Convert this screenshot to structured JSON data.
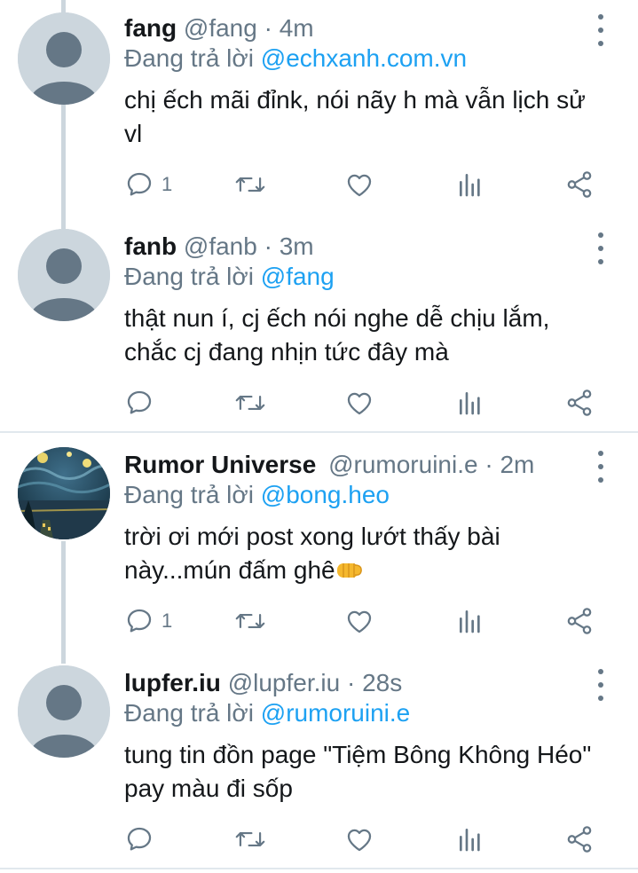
{
  "tweets": [
    {
      "name": "fang",
      "handle": "@fang",
      "sep": "·",
      "time": "4m",
      "reply_prefix": "Đang trả lời",
      "reply_to": "@echxanh.com.vn",
      "text": "chị ếch mãi đỉnk, nói nãy h mà vẫn lịch sử vl",
      "reply_count": "1",
      "retweet_count": "",
      "like_count": ""
    },
    {
      "name": "fanb",
      "handle": "@fanb",
      "sep": "·",
      "time": "3m",
      "reply_prefix": "Đang trả lời",
      "reply_to": "@fang",
      "text": "thật nun í, cj ếch nói nghe dễ chịu lắm, chắc cj đang nhịn tức đây mà",
      "reply_count": "",
      "retweet_count": "",
      "like_count": ""
    },
    {
      "name": "Rumor Universe",
      "handle": "@rumoruini.e",
      "sep": "·",
      "time": "2m",
      "reply_prefix": "Đang trả lời",
      "reply_to": "@bong.heo",
      "text": "trời ơi mới post xong lướt thấy bài này...mún đấm ghê",
      "emoji": "fist-emoji",
      "reply_count": "1",
      "retweet_count": "",
      "like_count": ""
    },
    {
      "name": "lupfer.iu",
      "handle": "@lupfer.iu",
      "sep": "·",
      "time": "28s",
      "reply_prefix": "Đang trả lời",
      "reply_to": "@rumoruini.e",
      "text": "tung tin đồn page \"Tiệm Bông Không Héo\" pay màu đi sốp",
      "reply_count": "",
      "retweet_count": "",
      "like_count": ""
    }
  ],
  "icons": [
    "reply-icon",
    "retweet-icon",
    "like-icon",
    "analytics-icon",
    "share-icon",
    "more-icon",
    "default-avatar-icon"
  ],
  "colors": {
    "link": "#1da1f2",
    "muted": "#657786",
    "text": "#14171a",
    "thread_line": "#ccd6dd",
    "divider": "#e1e8ed"
  }
}
